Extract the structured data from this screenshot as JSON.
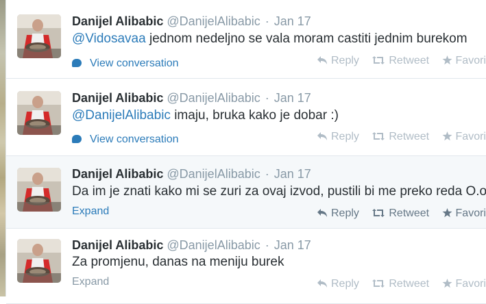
{
  "tweets": [
    {
      "fullname": "Danijel Alibabic",
      "username": "@DanijelAlibabic",
      "time": "Jan 17",
      "mention": "@Vidosavaa",
      "text": " jednom nedeljno se vala moram castiti jednim burekom",
      "footer": "View conversation"
    },
    {
      "fullname": "Danijel Alibabic",
      "username": "@DanijelAlibabic",
      "time": "Jan 17",
      "mention": "@DanijelAlibabic",
      "text": " imaju, bruka kako je dobar :)",
      "footer": "View conversation"
    },
    {
      "fullname": "Danijel Alibabic",
      "username": "@DanijelAlibabic",
      "time": "Jan 17",
      "mention": "",
      "text": "Da im je znati kako mi se zuri za ovaj izvod, pustili bi me preko reda O.o",
      "footer": "Expand"
    },
    {
      "fullname": "Danijel Alibabic",
      "username": "@DanijelAlibabic",
      "time": "Jan 17",
      "mention": "",
      "text": "Za promjenu, danas na meniju burek",
      "footer": "Expand"
    }
  ],
  "actions": {
    "reply": "Reply",
    "retweet": "Retweet",
    "favorite": "Favorite"
  },
  "separator": "·",
  "icons": [
    "reply-icon",
    "retweet-icon",
    "favorite-icon",
    "conversation-bubble-icon"
  ],
  "colors": {
    "link": "#2b7bb9",
    "muted": "#8899a6",
    "hover_bg": "#f5f8fa",
    "text": "#292f33"
  }
}
